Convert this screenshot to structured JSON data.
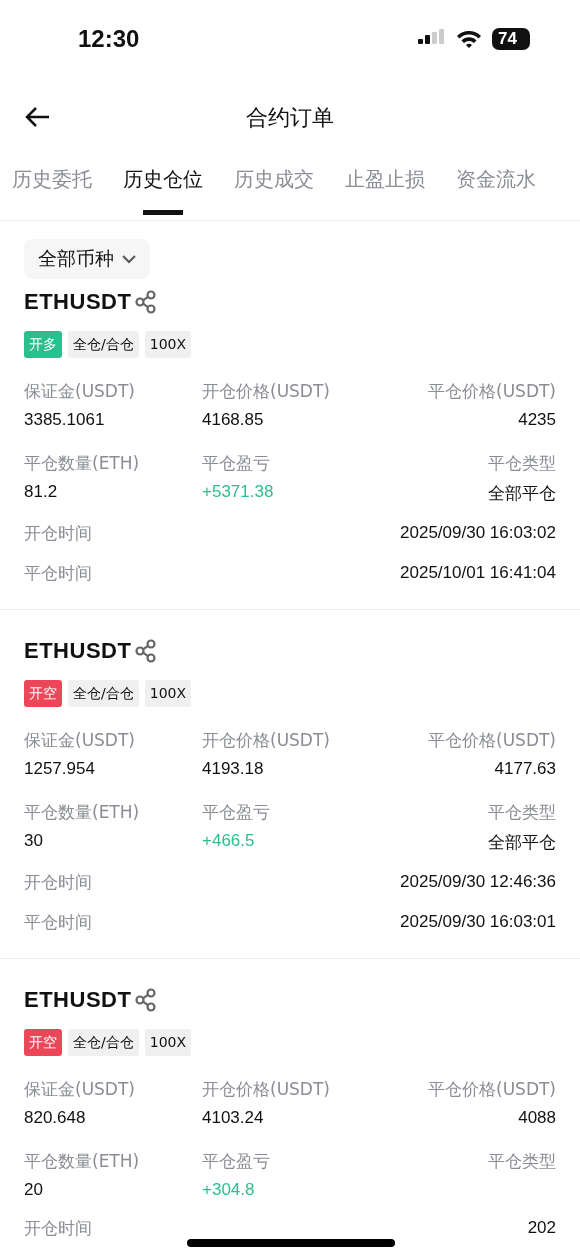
{
  "status_bar": {
    "time": "12:30",
    "battery": "74"
  },
  "header": {
    "title": "合约订单"
  },
  "tabs": [
    {
      "label": "历史委托",
      "selected": false
    },
    {
      "label": "历史仓位",
      "selected": true
    },
    {
      "label": "历史成交",
      "selected": false
    },
    {
      "label": "止盈止损",
      "selected": false
    },
    {
      "label": "资金流水",
      "selected": false
    }
  ],
  "filter": {
    "label": "全部币种"
  },
  "positions": [
    {
      "symbol": "ETHUSDT",
      "side": {
        "kind": "long",
        "label": "开多"
      },
      "tags": [
        "全仓/合仓",
        "100X"
      ],
      "stats": [
        {
          "label": "保证金(USDT)",
          "value": "3385.1061",
          "kind": "plain"
        },
        {
          "label": "开仓价格(USDT)",
          "value": "4168.85",
          "kind": "plain"
        },
        {
          "label": "平仓价格(USDT)",
          "value": "4235",
          "kind": "plain"
        },
        {
          "label": "平仓数量(ETH)",
          "value": "81.2",
          "kind": "plain"
        },
        {
          "label": "平仓盈亏",
          "value": "+5371.38",
          "kind": "profit"
        },
        {
          "label": "平仓类型",
          "value": "全部平仓",
          "kind": "plain"
        }
      ],
      "times": [
        {
          "label": "开仓时间",
          "value": "2025/09/30 16:03:02"
        },
        {
          "label": "平仓时间",
          "value": "2025/10/01 16:41:04"
        }
      ]
    },
    {
      "symbol": "ETHUSDT",
      "side": {
        "kind": "short",
        "label": "开空"
      },
      "tags": [
        "全仓/合仓",
        "100X"
      ],
      "stats": [
        {
          "label": "保证金(USDT)",
          "value": "1257.954",
          "kind": "plain"
        },
        {
          "label": "开仓价格(USDT)",
          "value": "4193.18",
          "kind": "plain"
        },
        {
          "label": "平仓价格(USDT)",
          "value": "4177.63",
          "kind": "plain"
        },
        {
          "label": "平仓数量(ETH)",
          "value": "30",
          "kind": "plain"
        },
        {
          "label": "平仓盈亏",
          "value": "+466.5",
          "kind": "profit"
        },
        {
          "label": "平仓类型",
          "value": "全部平仓",
          "kind": "plain"
        }
      ],
      "times": [
        {
          "label": "开仓时间",
          "value": "2025/09/30 12:46:36"
        },
        {
          "label": "平仓时间",
          "value": "2025/09/30 16:03:01"
        }
      ]
    },
    {
      "symbol": "ETHUSDT",
      "side": {
        "kind": "short",
        "label": "开空"
      },
      "tags": [
        "全仓/合仓",
        "100X"
      ],
      "stats": [
        {
          "label": "保证金(USDT)",
          "value": "820.648",
          "kind": "plain"
        },
        {
          "label": "开仓价格(USDT)",
          "value": "4103.24",
          "kind": "plain"
        },
        {
          "label": "平仓价格(USDT)",
          "value": "4088",
          "kind": "plain"
        },
        {
          "label": "平仓数量(ETH)",
          "value": "20",
          "kind": "plain"
        },
        {
          "label": "平仓盈亏",
          "value": "+304.8",
          "kind": "profit"
        },
        {
          "label": "平仓类型"
        }
      ],
      "times": [
        {
          "label": "开仓时间",
          "value": "202"
        }
      ]
    }
  ]
}
